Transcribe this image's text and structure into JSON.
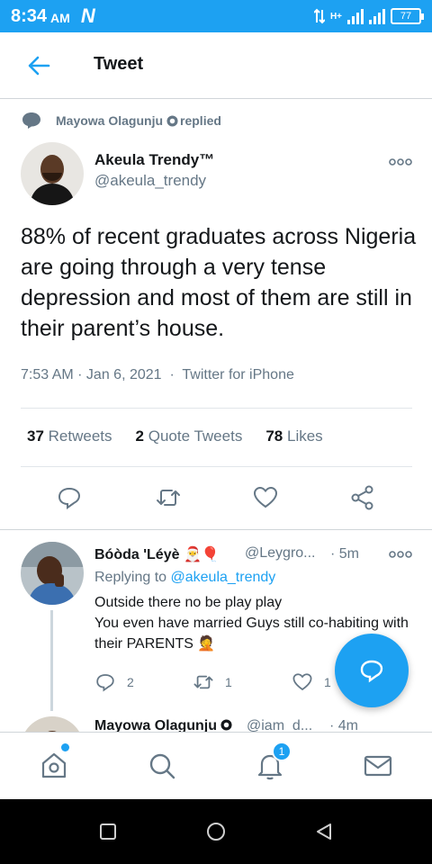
{
  "status_bar": {
    "time": "8:34",
    "ampm": "AM",
    "carrier_logo": "N",
    "network": "H+",
    "battery": "77"
  },
  "header": {
    "title": "Tweet",
    "back_icon": "arrow-left-icon"
  },
  "context": {
    "user": "Mayowa Olagunju",
    "action": "replied"
  },
  "tweet": {
    "author_name": "Akeula Trendy™",
    "author_handle": "@akeula_trendy",
    "text": "88% of recent graduates across Nigeria are going through a very tense depression and most of them are still in their parent’s house.",
    "time": "7:53 AM",
    "date": "Jan 6, 2021",
    "source": "Twitter for iPhone",
    "retweets": "37",
    "retweets_label": "Retweets",
    "quotes": "2",
    "quotes_label": "Quote Tweets",
    "likes": "78",
    "likes_label": "Likes"
  },
  "reply": {
    "name": "Bóòda 'Léyè",
    "emoji": "🎅🎈",
    "handle": "@Leygro...",
    "time": "· 5m",
    "replying_prefix": "Replying to",
    "replying_to": "@akeula_trendy",
    "line1": "Outside there no be play play",
    "line2": "You even have married Guys still co-habiting with their PARENTS",
    "line2_emoji": "🤦",
    "reply_count": "2",
    "retweet_count": "1",
    "like_count": "1"
  },
  "next_reply": {
    "name": "Mayowa Olagunju",
    "handle": "@iam_d...",
    "time": "· 4m"
  },
  "bottom_nav": {
    "notifications_badge": "1"
  },
  "colors": {
    "brand": "#1da1f2",
    "secondary_text": "#657786"
  }
}
